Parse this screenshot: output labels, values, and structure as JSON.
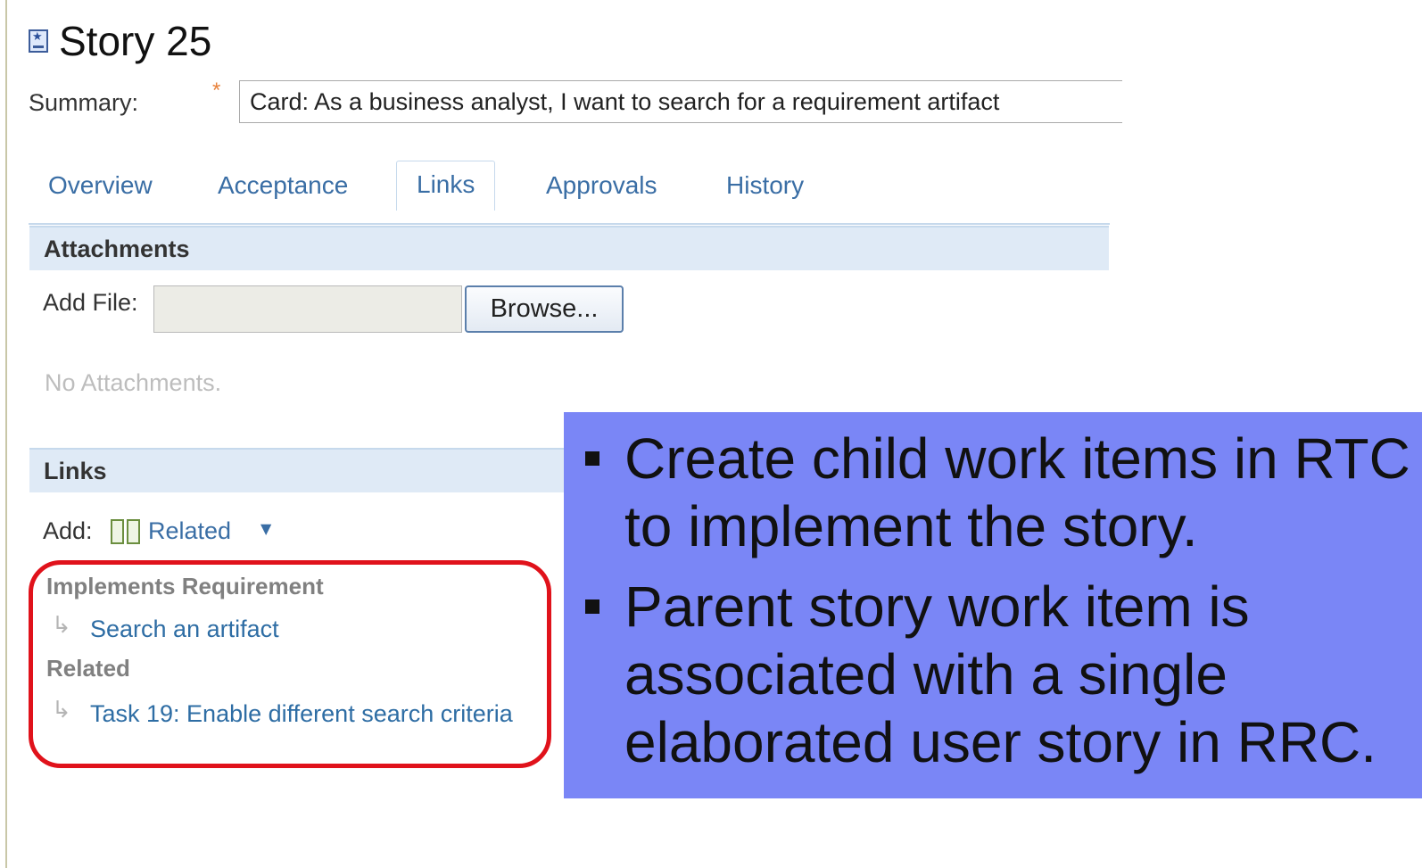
{
  "title": "Story 25",
  "summary": {
    "label": "Summary:",
    "required_mark": "*",
    "value": "Card: As a business analyst, I want to search for a requirement artifact"
  },
  "tabs": [
    {
      "label": "Overview",
      "active": false
    },
    {
      "label": "Acceptance",
      "active": false
    },
    {
      "label": "Links",
      "active": true
    },
    {
      "label": "Approvals",
      "active": false
    },
    {
      "label": "History",
      "active": false
    }
  ],
  "attachments": {
    "header": "Attachments",
    "add_file_label": "Add File:",
    "browse_label": "Browse...",
    "empty_text": "No Attachments."
  },
  "links": {
    "header": "Links",
    "add_label": "Add:",
    "related_label": "Related",
    "groups": [
      {
        "title": "Implements Requirement",
        "items": [
          "Search an artifact"
        ]
      },
      {
        "title": "Related",
        "items": [
          "Task 19: Enable different search criteria"
        ]
      }
    ]
  },
  "callout": {
    "bullets": [
      "Create child work items in RTC to implement the story.",
      "Parent story work item is associated with a single elaborated user story in RRC."
    ]
  },
  "colors": {
    "link": "#2e6da4",
    "tab_text": "#3a6ea5",
    "section_header_bg": "#dfeaf6",
    "highlight": "#e0121b",
    "callout_bg": "#7a86f6",
    "required": "#e8813a"
  },
  "icons": [
    "story-icon",
    "related-links-icon",
    "chevron-down-icon",
    "link-arrow-icon",
    "bullet-icon"
  ]
}
